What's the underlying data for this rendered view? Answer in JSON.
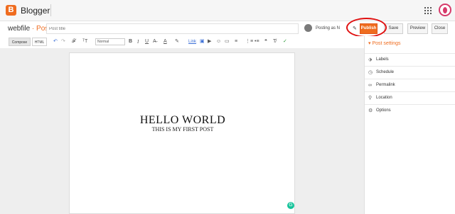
{
  "app": {
    "logo_letter": "B",
    "name": "Blogger",
    "accent_color": "#ef6c1f"
  },
  "post": {
    "blog_name": "webfile",
    "separator": " · ",
    "label": "Post",
    "title_placeholder": "Post title",
    "posting_as": "Posting as N",
    "edit_icon": "pencil-icon"
  },
  "actions": {
    "publish": "Publish",
    "save": "Save",
    "preview": "Preview",
    "close": "Close"
  },
  "toolbar": {
    "compose": "Compose",
    "html": "HTML",
    "font_size": "Normal",
    "undo": "↶",
    "redo": "↷",
    "font_family": "𝓕",
    "text_size": "ᵀT",
    "bold": "B",
    "italic": "I",
    "underline": "U",
    "strike": "A̶",
    "text_color": "A",
    "highlight": "✎",
    "link": "Link",
    "image": "▣",
    "video": "▶",
    "emoji": "☺",
    "jump_break": "▭",
    "align": "≡",
    "numbered_list": "⋮≡",
    "bullet_list": "•≡",
    "quote": "❝",
    "clear_format": "T̸",
    "spellcheck": "✓"
  },
  "document": {
    "heading": "HELLO WORLD",
    "subheading": "THIS IS MY FIRST POST"
  },
  "sidebar": {
    "title": "Post settings",
    "items": [
      {
        "label": "Labels",
        "icon": "tag-icon"
      },
      {
        "label": "Schedule",
        "icon": "clock-icon"
      },
      {
        "label": "Permalink",
        "icon": "link-icon"
      },
      {
        "label": "Location",
        "icon": "location-pin-icon"
      },
      {
        "label": "Options",
        "icon": "gear-icon"
      }
    ]
  }
}
